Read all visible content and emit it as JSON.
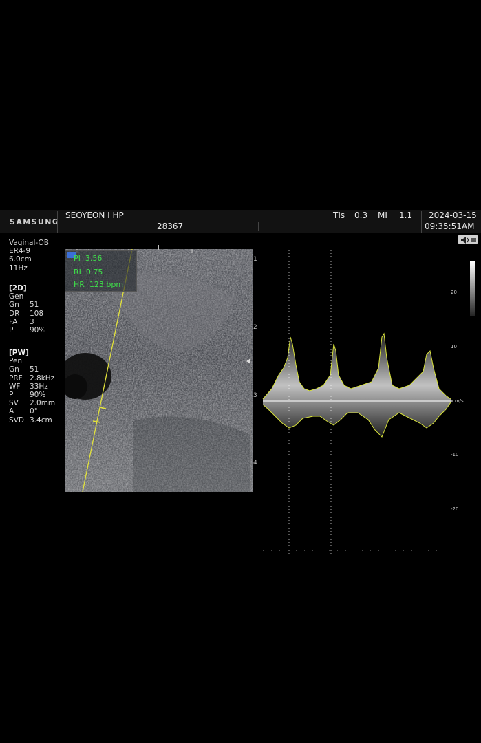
{
  "header": {
    "brand": "SAMSUNG",
    "hospital": "SEOYEON I HP",
    "patient_id": "28367",
    "tis_label": "TIs",
    "tis_value": "0.3",
    "mi_label": "MI",
    "mi_value": "1.1",
    "date": "2024-03-15",
    "time": "09:35:51AM"
  },
  "probe": {
    "preset": "Vaginal-OB",
    "transducer": "ER4-9",
    "depth": "6.0cm",
    "frame_rate": "11Hz"
  },
  "mode_2d": {
    "title": "[2D]",
    "mode": "Gen",
    "params": [
      {
        "k": "Gn",
        "v": "51"
      },
      {
        "k": "DR",
        "v": "108"
      },
      {
        "k": "FA",
        "v": "3"
      },
      {
        "k": "P",
        "v": "90%"
      }
    ]
  },
  "mode_pw": {
    "title": "[PW]",
    "mode": "Pen",
    "params": [
      {
        "k": "Gn",
        "v": "51"
      },
      {
        "k": "PRF",
        "v": "2.8kHz"
      },
      {
        "k": "WF",
        "v": "33Hz"
      },
      {
        "k": "P",
        "v": "90%"
      },
      {
        "k": "SV",
        "v": "2.0mm"
      },
      {
        "k": "A",
        "v": "0°"
      },
      {
        "k": "SVD",
        "v": "3.4cm"
      }
    ]
  },
  "measurements": [
    {
      "label": "PI",
      "value": "3.56"
    },
    {
      "label": "RI",
      "value": "0.75"
    },
    {
      "label": "HR",
      "value": "123 bpm"
    }
  ],
  "image_depth_ticks": [
    "1",
    "2",
    "3",
    "4"
  ],
  "doppler_scale": {
    "unit": "cm/s",
    "ticks": [
      "20",
      "10",
      "-10",
      "-20"
    ]
  },
  "colors": {
    "measure": "#3fe04a",
    "spectrum_trace": "#d8e23a",
    "cursor": "#e3e33b"
  },
  "icons": {
    "doppler_sound": "speaker-icon"
  }
}
